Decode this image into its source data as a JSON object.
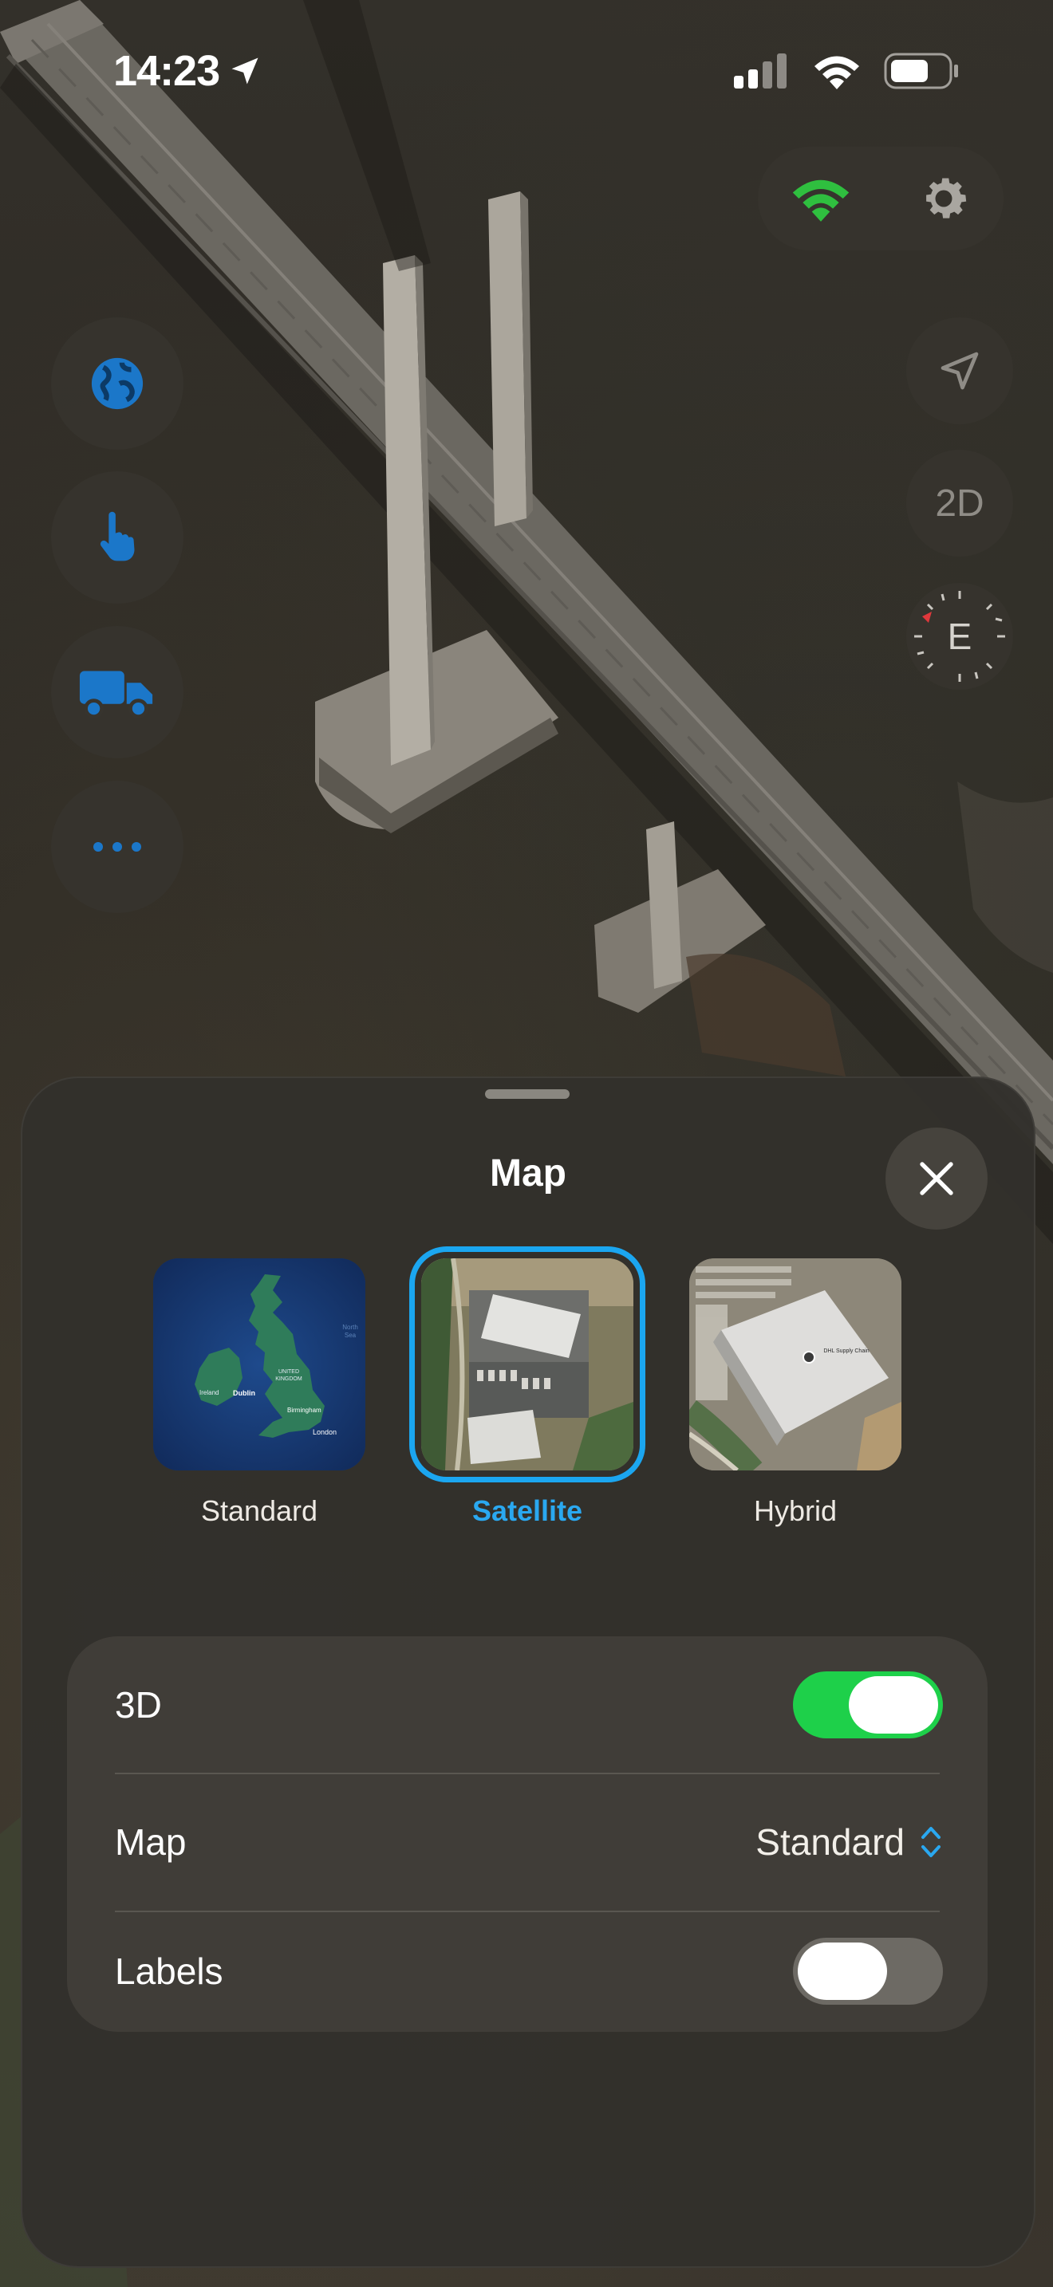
{
  "status_bar": {
    "time": "14:23",
    "icons": [
      "location-arrow-icon",
      "cellular-signal-icon",
      "wifi-icon",
      "battery-icon"
    ]
  },
  "map_controls": {
    "left": [
      "globe-icon",
      "hand-pointer-icon",
      "truck-icon",
      "more-icon"
    ],
    "top_right": [
      "wifi-status-icon",
      "gear-icon"
    ],
    "right": {
      "locate_icon": "navigation-arrow-icon",
      "view_mode": "2D",
      "compass_heading": "E"
    }
  },
  "sheet": {
    "title": "Map",
    "close_icon": "close-icon",
    "map_types": [
      {
        "label": "Standard",
        "selected": false
      },
      {
        "label": "Satellite",
        "selected": true
      },
      {
        "label": "Hybrid",
        "selected": false
      }
    ],
    "thumb_text": {
      "standard": [
        "Ireland",
        "Dublin",
        "UNITED KINGDOM",
        "Birmingham",
        "London",
        "North Sea"
      ],
      "hybrid": "DHL Supply Chain"
    },
    "settings": [
      {
        "label": "3D",
        "type": "toggle",
        "on": true
      },
      {
        "label": "Map",
        "type": "select",
        "value": "Standard"
      },
      {
        "label": "Labels",
        "type": "toggle",
        "on": false
      }
    ]
  },
  "colors": {
    "accent": "#1ba6f0",
    "toggle_on": "#1ed04a",
    "toggle_off": "#6d6a64",
    "control_icon": "#1b77c9",
    "wifi_green": "#2fbf3f"
  }
}
